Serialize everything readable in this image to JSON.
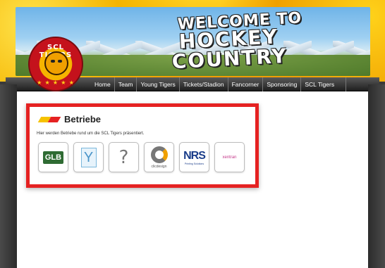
{
  "header": {
    "title_line1": "WELCOME TO",
    "title_line2": "HOCKEY COUNTRY"
  },
  "logo": {
    "text": "SCL TIGERS",
    "stars": "★ ★ ★ ★ ★"
  },
  "nav": {
    "items": [
      "Home",
      "Team",
      "Young Tigers",
      "Tickets/Stadion",
      "Fancorner",
      "Sponsoring",
      "SCL Tigers"
    ]
  },
  "section": {
    "title": "Betriebe",
    "description": "Hier werden Betriebe rund um die SCL Tigers präsentiert."
  },
  "sponsors": [
    {
      "name": "GLB",
      "icon": "glb-logo"
    },
    {
      "name": "Y",
      "icon": "y-logo"
    },
    {
      "name": "?",
      "icon": "unknown-logo"
    },
    {
      "name": "clicdesign",
      "icon": "clicdesign-logo"
    },
    {
      "name": "NRS",
      "sub": "Printing Solutions",
      "icon": "nrs-logo"
    },
    {
      "name": "xentran",
      "icon": "xentran-logo"
    }
  ],
  "colors": {
    "accent_red": "#e52222",
    "accent_yellow": "#f6c200",
    "navbar": "#1e1e1e"
  }
}
